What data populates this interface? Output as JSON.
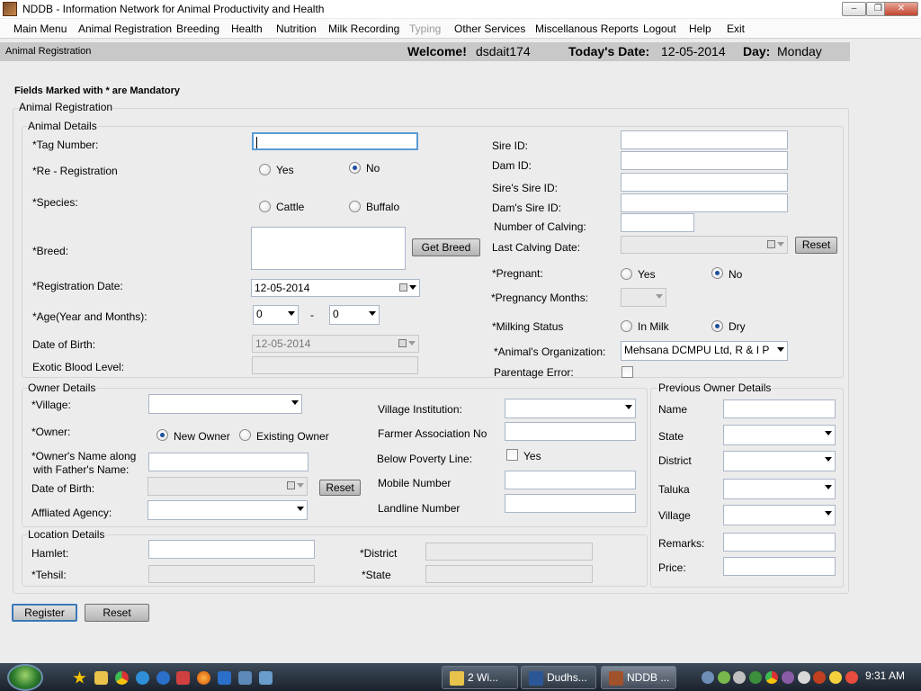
{
  "window": {
    "title": "NDDB - Information Network for Animal Productivity and Health"
  },
  "menu": [
    "Main Menu",
    "Animal Registration",
    "Breeding",
    "Health",
    "Nutrition",
    "Milk Recording",
    "Typing",
    "Other Services",
    "Miscellanous Reports",
    "Logout",
    "Help",
    "Exit"
  ],
  "status": {
    "breadcrumb": "Animal Registration",
    "welcome_label": "Welcome!",
    "user": "dsdait174",
    "date_label": "Today's Date:",
    "date": "12-05-2014",
    "day_label": "Day:",
    "day": "Monday"
  },
  "mandatory_note": "Fields Marked with * are Mandatory",
  "form_title": "Animal Registration",
  "animal": {
    "group": "Animal Details",
    "tag_label": "*Tag Number:",
    "rereg_label": "*Re - Registration",
    "rereg_yes": "Yes",
    "rereg_no": "No",
    "species_label": "*Species:",
    "species_cattle": "Cattle",
    "species_buffalo": "Buffalo",
    "breed_label": "*Breed:",
    "get_breed": "Get Breed",
    "regdate_label": "*Registration Date:",
    "regdate": "12-05-2014",
    "age_label": "*Age(Year and Months):",
    "age_years": "0",
    "age_dash": "-",
    "age_months": "0",
    "dob_label": "Date of Birth:",
    "dob": "12-05-2014",
    "exotic_label": "Exotic Blood Level:",
    "sire_label": "Sire ID:",
    "dam_label": "Dam ID:",
    "sire_sire_label": "Sire's Sire ID:",
    "dam_sire_label": "Dam's Sire ID:",
    "calving_label": "Number of Calving:",
    "last_calving_label": "Last Calving Date:",
    "reset": "Reset",
    "pregnant_label": "*Pregnant:",
    "pregnant_yes": "Yes",
    "pregnant_no": "No",
    "preg_months_label": "*Pregnancy Months:",
    "milking_label": "*Milking Status",
    "milk_in": "In Milk",
    "milk_dry": "Dry",
    "org_label": "*Animal's Organization:",
    "org_value": "Mehsana DCMPU Ltd, R & I P",
    "parentage_label": "Parentage Error:"
  },
  "owner": {
    "group": "Owner Details",
    "village_label": "*Village:",
    "owner_label": "*Owner:",
    "new_owner": "New Owner",
    "existing_owner": "Existing Owner",
    "name_label_1": "*Owner's Name along",
    "name_label_2": "with Father's Name:",
    "dob_label": "Date of Birth:",
    "reset": "Reset",
    "agency_label": "Affliated Agency:",
    "institution_label": "Village Institution:",
    "farmer_assoc_label": "Farmer Association No",
    "bpl_label": "Below Poverty Line:",
    "bpl_yes": "Yes",
    "mobile_label": "Mobile Number",
    "landline_label": "Landline Number"
  },
  "previous_owner": {
    "group": "Previous Owner Details",
    "name_label": "Name",
    "state_label": "State",
    "district_label": "District",
    "taluka_label": "Taluka",
    "village_label": "Village",
    "remarks_label": "Remarks:",
    "price_label": "Price:"
  },
  "location": {
    "group": "Location Details",
    "hamlet_label": "Hamlet:",
    "tehsil_label": "*Tehsil:",
    "district_label": "*District",
    "state_label": "*State"
  },
  "buttons": {
    "register": "Register",
    "reset": "Reset"
  },
  "taskbar": {
    "tasks": [
      "2 Wi...",
      "Dudhs...",
      "NDDB ..."
    ],
    "clock": "9:31 AM"
  }
}
